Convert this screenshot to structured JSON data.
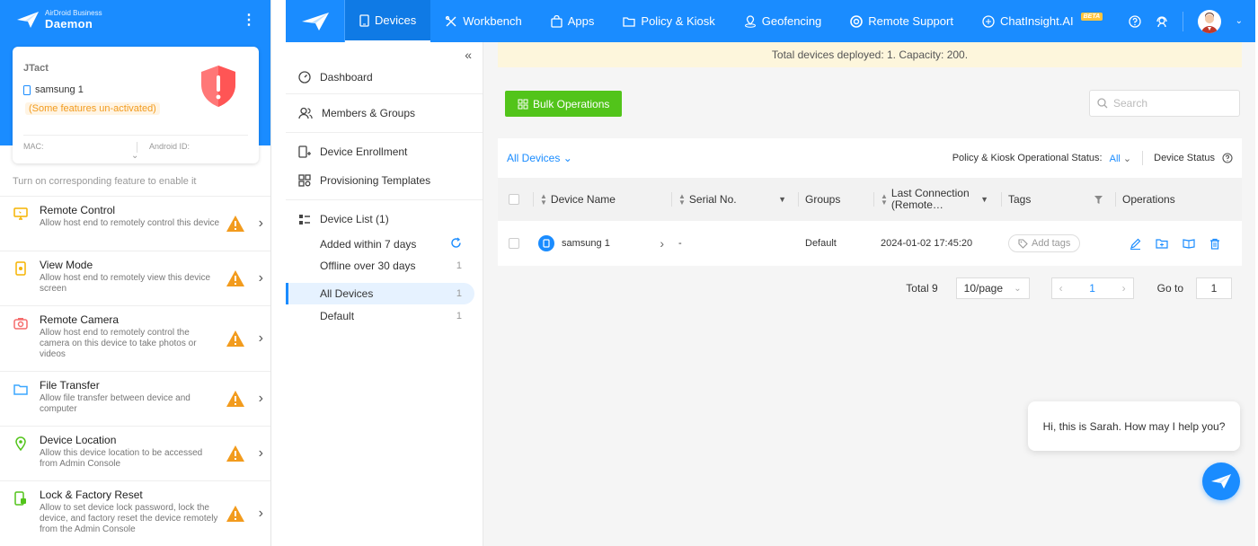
{
  "phone": {
    "brand_small": "AirDroid Business",
    "brand_big": "Daemon",
    "card": {
      "name": "JTact",
      "device": "samsung 1",
      "warning": "(Some features un-activated)",
      "mac_label": "MAC:",
      "android_id_label": "Android ID:"
    },
    "hint": "Turn on corresponding feature to enable it",
    "features": [
      {
        "title": "Remote Control",
        "desc": "Allow host end to remotely control this device"
      },
      {
        "title": "View Mode",
        "desc": "Allow host end to remotely view this device screen"
      },
      {
        "title": "Remote Camera",
        "desc": "Allow host end to remotely control the camera on this device to take photos or videos"
      },
      {
        "title": "File Transfer",
        "desc": "Allow file transfer between device and computer"
      },
      {
        "title": "Device Location",
        "desc": "Allow this device location to be accessed from Admin Console"
      },
      {
        "title": "Lock & Factory Reset",
        "desc": "Allow to set device lock password, lock the device, and factory reset the device remotely from the Admin Console"
      }
    ]
  },
  "nav": {
    "items": [
      "Devices",
      "Workbench",
      "Apps",
      "Policy & Kiosk",
      "Geofencing",
      "Remote Support",
      "ChatInsight.AI"
    ],
    "beta": "BETA"
  },
  "sidebar": {
    "dashboard": "Dashboard",
    "members": "Members & Groups",
    "enrollment": "Device Enrollment",
    "provisioning": "Provisioning Templates",
    "device_list": "Device List (1)",
    "sub": [
      {
        "label": "Added within 7 days",
        "count": ""
      },
      {
        "label": "Offline over 30 days",
        "count": "1"
      },
      {
        "label": "All Devices",
        "count": "1"
      },
      {
        "label": "Default",
        "count": "1"
      }
    ]
  },
  "main": {
    "banner": "Total devices deployed: 1. Capacity: 200.",
    "bulk_label": "Bulk Operations",
    "search_placeholder": "Search",
    "filter_label": "All Devices",
    "policy_status_label": "Policy & Kiosk Operational Status:",
    "policy_status_value": "All",
    "device_status_label": "Device Status",
    "columns": {
      "device_name": "Device Name",
      "serial": "Serial No.",
      "groups": "Groups",
      "last_connection": "Last Connection (Remote…",
      "tags": "Tags",
      "operations": "Operations"
    },
    "row": {
      "device_name": "samsung 1",
      "serial": "-",
      "group": "Default",
      "last_connection": "2024-01-02 17:45:20",
      "add_tags": "Add tags"
    },
    "pager": {
      "total": "Total 9",
      "per_page": "10/page",
      "current": "1",
      "goto_label": "Go to",
      "goto_value": "1"
    }
  },
  "chat": {
    "message": "Hi, this is Sarah. How may I help you?"
  },
  "colors": {
    "brand": "#1a8cff",
    "success": "#52c41a",
    "warning": "#f29b1d"
  }
}
